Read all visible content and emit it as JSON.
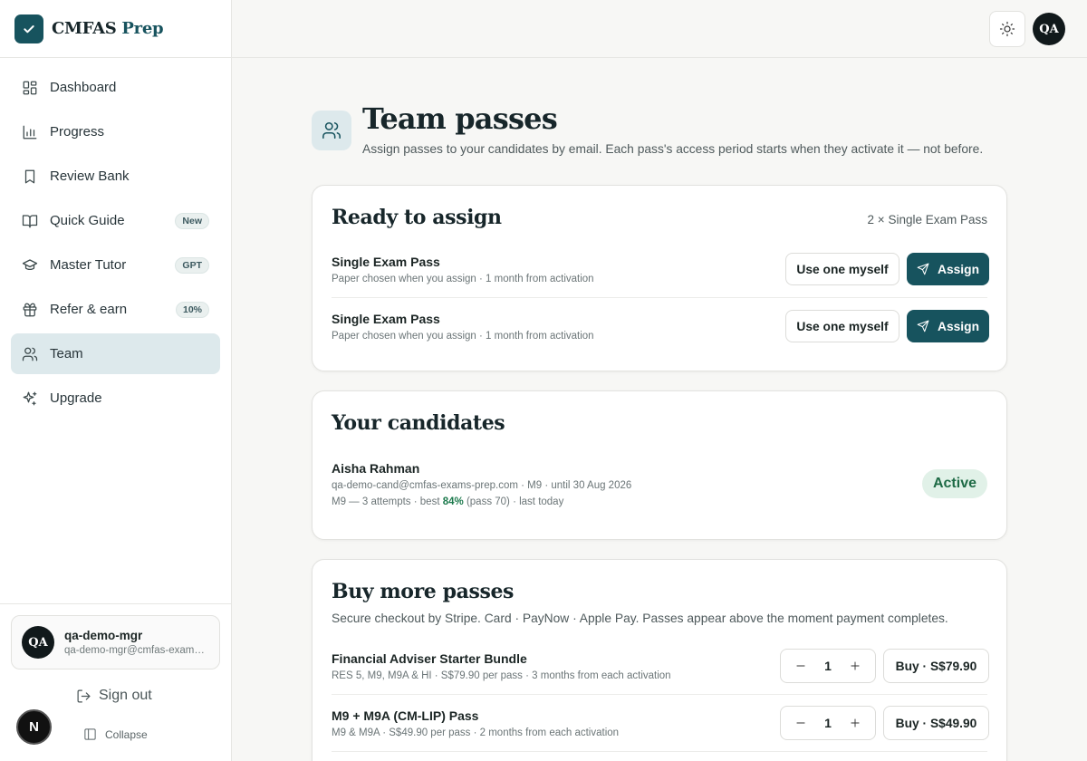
{
  "brand": {
    "name_main": "CMFAS",
    "name_accent": "Prep"
  },
  "sidebar": {
    "items": [
      {
        "label": "Dashboard",
        "icon": "dashboard-icon"
      },
      {
        "label": "Progress",
        "icon": "bar-chart-icon"
      },
      {
        "label": "Review Bank",
        "icon": "bookmark-icon"
      },
      {
        "label": "Quick Guide",
        "icon": "book-open-icon",
        "badge": "New"
      },
      {
        "label": "Master Tutor",
        "icon": "graduation-cap-icon",
        "badge": "GPT"
      },
      {
        "label": "Refer & earn",
        "icon": "gift-icon",
        "badge": "10%"
      },
      {
        "label": "Team",
        "icon": "users-icon",
        "active": true
      },
      {
        "label": "Upgrade",
        "icon": "sparkles-icon"
      }
    ],
    "user": {
      "initials": "QA",
      "name": "qa-demo-mgr",
      "email": "qa-demo-mgr@cmfas-exams-prep.com"
    },
    "sign_out": "Sign out",
    "collapse": "Collapse",
    "n_badge": "N"
  },
  "topbar": {
    "avatar_initials": "QA",
    "theme_icon": "sun-icon"
  },
  "page": {
    "title": "Team passes",
    "subtitle": "Assign passes to your candidates by email. Each pass's access period starts when they activate it — not before."
  },
  "ready": {
    "title": "Ready to assign",
    "summary": "2 × Single Exam Pass",
    "passes": [
      {
        "name": "Single Exam Pass",
        "detail": "Paper chosen when you assign · 1 month from activation",
        "self_label": "Use one myself",
        "assign_label": "Assign"
      },
      {
        "name": "Single Exam Pass",
        "detail": "Paper chosen when you assign · 1 month from activation",
        "self_label": "Use one myself",
        "assign_label": "Assign"
      }
    ]
  },
  "candidates": {
    "title": "Your candidates",
    "list": [
      {
        "name": "Aisha Rahman",
        "detail": "qa-demo-cand@cmfas-exams-prep.com · M9 · until 30 Aug 2026",
        "stats_prefix": "M9 — 3 attempts · best ",
        "best": "84%",
        "stats_suffix": " (pass 70) · last today",
        "status": "Active"
      }
    ]
  },
  "buy": {
    "title": "Buy more passes",
    "subtitle": "Secure checkout by Stripe. Card · PayNow · Apple Pay. Passes appear above the moment payment completes.",
    "products": [
      {
        "name": "Financial Adviser Starter Bundle",
        "detail": "RES 5, M9, M9A & HI · S$79.90 per pass · 3 months from each activation",
        "qty": "1",
        "buy_label": "Buy · S$79.90"
      },
      {
        "name": "M9 + M9A (CM-LIP) Pass",
        "detail": "M9 & M9A · S$49.90 per pass · 2 months from each activation",
        "qty": "1",
        "buy_label": "Buy · S$49.90"
      }
    ]
  }
}
